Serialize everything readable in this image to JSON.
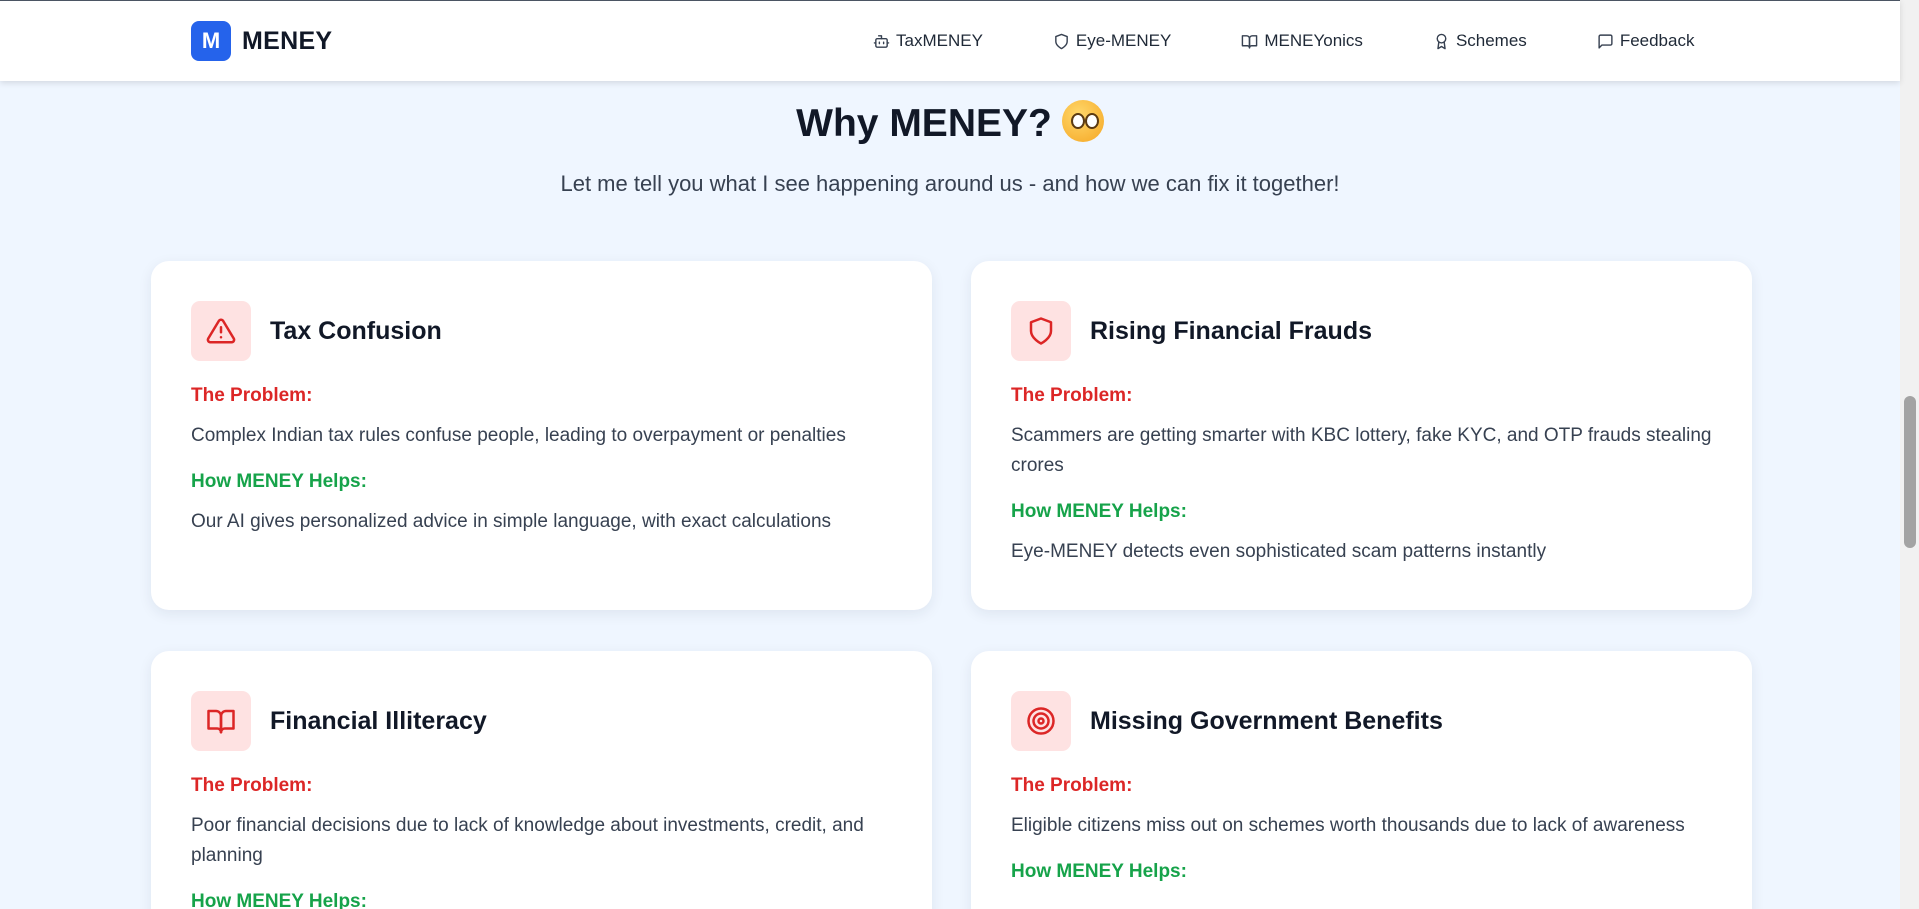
{
  "nav": {
    "logo_letter": "M",
    "brand": "MENEY",
    "items": [
      {
        "label": "TaxMENEY",
        "icon": "robot-icon"
      },
      {
        "label": "Eye-MENEY",
        "icon": "shield-icon"
      },
      {
        "label": "MENEYonics",
        "icon": "book-icon"
      },
      {
        "label": "Schemes",
        "icon": "award-icon"
      },
      {
        "label": "Feedback",
        "icon": "message-icon"
      }
    ]
  },
  "section": {
    "title": "Why MENEY?",
    "emoji": "thinking-face-emoji",
    "subtitle": "Let me tell you what I see happening around us - and how we can fix it together!"
  },
  "cards": [
    {
      "icon": "warning-triangle-icon",
      "title": "Tax Confusion",
      "problem_label": "The Problem:",
      "problem": "Complex Indian tax rules confuse people, leading to overpayment or penalties",
      "help_label": "How MENEY Helps:",
      "help": "Our AI gives personalized advice in simple language, with exact calculations"
    },
    {
      "icon": "shield-icon",
      "title": "Rising Financial Frauds",
      "problem_label": "The Problem:",
      "problem": "Scammers are getting smarter with KBC lottery, fake KYC, and OTP frauds stealing crores",
      "help_label": "How MENEY Helps:",
      "help": "Eye-MENEY detects even sophisticated scam patterns instantly"
    },
    {
      "icon": "book-open-icon",
      "title": "Financial Illiteracy",
      "problem_label": "The Problem:",
      "problem": "Poor financial decisions due to lack of knowledge about investments, credit, and planning",
      "help_label": "How MENEY Helps:",
      "help": ""
    },
    {
      "icon": "target-icon",
      "title": "Missing Government Benefits",
      "problem_label": "The Problem:",
      "problem": "Eligible citizens miss out on schemes worth thousands due to lack of awareness",
      "help_label": "How MENEY Helps:",
      "help": ""
    }
  ],
  "colors": {
    "page_bg": "#eff6ff",
    "brand_blue": "#2563eb",
    "problem_red": "#dc2626",
    "help_green": "#16a34a",
    "icon_bg": "#fee2e2"
  }
}
